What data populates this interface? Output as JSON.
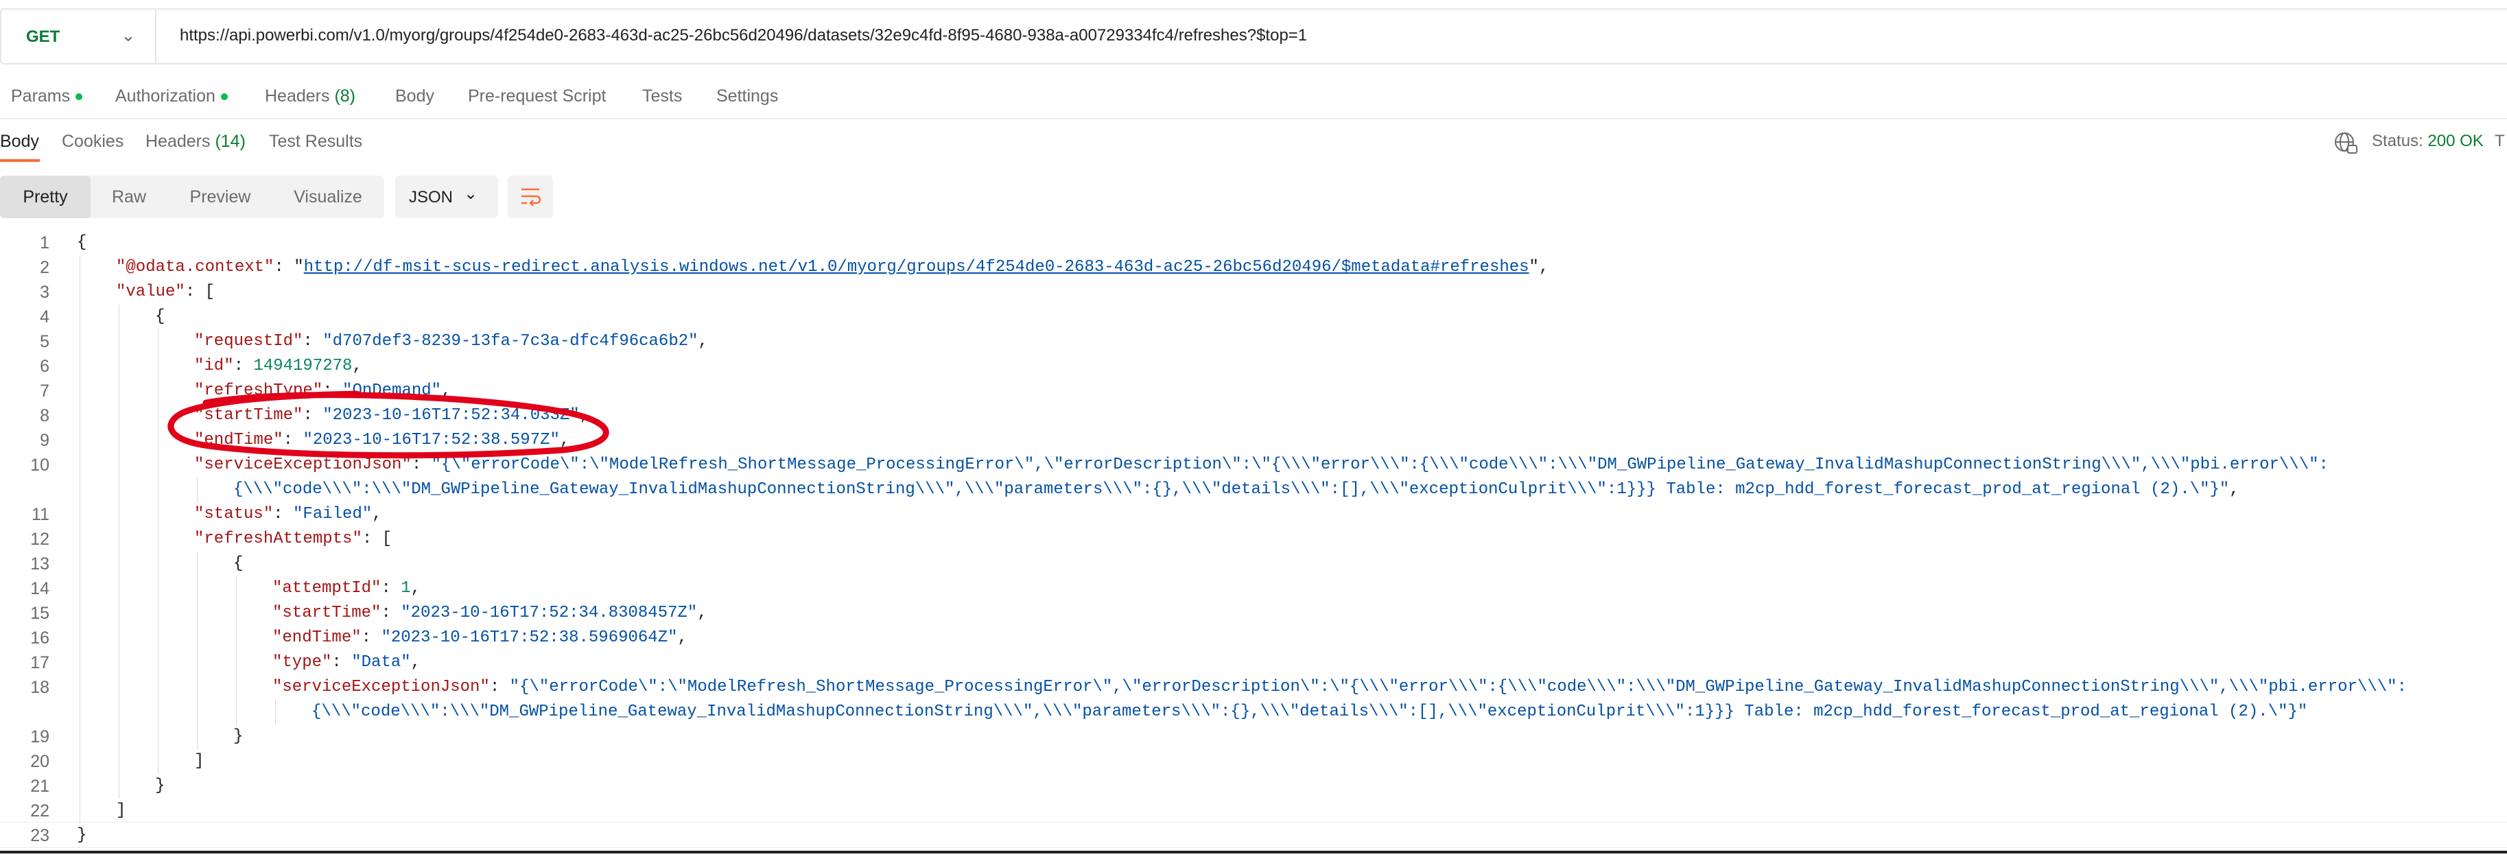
{
  "request": {
    "method": "GET",
    "url": "https://api.powerbi.com/v1.0/myorg/groups/4f254de0-2683-463d-ac25-26bc56d20496/datasets/32e9c4fd-8f95-4680-938a-a00729334fc4/refreshes?$top=1"
  },
  "request_tabs": [
    {
      "label": "Params",
      "dot": true
    },
    {
      "label": "Authorization",
      "dot": true
    },
    {
      "label": "Headers",
      "count": "(8)"
    },
    {
      "label": "Body"
    },
    {
      "label": "Pre-request Script"
    },
    {
      "label": "Tests"
    },
    {
      "label": "Settings"
    }
  ],
  "response_tabs": [
    {
      "label": "Body",
      "active": true
    },
    {
      "label": "Cookies"
    },
    {
      "label": "Headers",
      "count": "(14)"
    },
    {
      "label": "Test Results"
    }
  ],
  "status": {
    "label": "Status:",
    "value": "200 OK",
    "extra": "T"
  },
  "view_modes": [
    "Pretty",
    "Raw",
    "Preview",
    "Visualize"
  ],
  "format": "JSON",
  "icons": [
    "chevron-down-icon",
    "globe-icon",
    "wrap-lines-icon"
  ],
  "colors": {
    "accent": "#ff6c37",
    "success": "#0a7c33",
    "key": "#a31515",
    "string": "#0451a5",
    "number": "#098658",
    "annotation": "#e0001a"
  },
  "code_lines": [
    {
      "n": "1",
      "indent": 0,
      "tokens": [
        {
          "t": "{",
          "c": "p"
        }
      ]
    },
    {
      "n": "2",
      "indent": 1,
      "tokens": [
        {
          "t": "\"@odata.context\"",
          "c": "k"
        },
        {
          "t": ": \"",
          "c": "p"
        },
        {
          "t": "http://df-msit-scus-redirect.analysis.windows.net/v1.0/myorg/groups/4f254de0-2683-463d-ac25-26bc56d20496/$metadata#refreshes",
          "c": "u"
        },
        {
          "t": "\",",
          "c": "p"
        }
      ]
    },
    {
      "n": "3",
      "indent": 1,
      "tokens": [
        {
          "t": "\"value\"",
          "c": "k"
        },
        {
          "t": ": [",
          "c": "p"
        }
      ]
    },
    {
      "n": "4",
      "indent": 2,
      "tokens": [
        {
          "t": "{",
          "c": "p"
        }
      ]
    },
    {
      "n": "5",
      "indent": 3,
      "tokens": [
        {
          "t": "\"requestId\"",
          "c": "k"
        },
        {
          "t": ": ",
          "c": "p"
        },
        {
          "t": "\"d707def3-8239-13fa-7c3a-dfc4f96ca6b2\"",
          "c": "s"
        },
        {
          "t": ",",
          "c": "p"
        }
      ]
    },
    {
      "n": "6",
      "indent": 3,
      "tokens": [
        {
          "t": "\"id\"",
          "c": "k"
        },
        {
          "t": ": ",
          "c": "p"
        },
        {
          "t": "1494197278",
          "c": "n"
        },
        {
          "t": ",",
          "c": "p"
        }
      ]
    },
    {
      "n": "7",
      "indent": 3,
      "tokens": [
        {
          "t": "\"refreshType\"",
          "c": "k"
        },
        {
          "t": ": ",
          "c": "p"
        },
        {
          "t": "\"OnDemand\"",
          "c": "s"
        },
        {
          "t": ",",
          "c": "p"
        }
      ]
    },
    {
      "n": "8",
      "indent": 3,
      "tokens": [
        {
          "t": "\"startTime\"",
          "c": "k"
        },
        {
          "t": ": ",
          "c": "p"
        },
        {
          "t": "\"2023-10-16T17:52:34.033Z\"",
          "c": "s"
        },
        {
          "t": ",",
          "c": "p"
        }
      ]
    },
    {
      "n": "9",
      "indent": 3,
      "tokens": [
        {
          "t": "\"endTime\"",
          "c": "k"
        },
        {
          "t": ": ",
          "c": "p"
        },
        {
          "t": "\"2023-10-16T17:52:38.597Z\"",
          "c": "s"
        },
        {
          "t": ",",
          "c": "p"
        }
      ]
    },
    {
      "n": "10",
      "indent": 3,
      "tokens": [
        {
          "t": "\"serviceExceptionJson\"",
          "c": "k"
        },
        {
          "t": ": ",
          "c": "p"
        },
        {
          "t": "\"{\\\"errorCode\\\":\\\"ModelRefresh_ShortMessage_ProcessingError\\\",\\\"errorDescription\\\":\\\"{\\\\\\\"error\\\\\\\":{\\\\\\\"code\\\\\\\":\\\\\\\"DM_GWPipeline_Gateway_InvalidMashupConnectionString\\\\\\\",\\\\\\\"pbi.error\\\\\\\":",
          "c": "s"
        }
      ]
    },
    {
      "n": "",
      "indent": 4,
      "tokens": [
        {
          "t": "{\\\\\\\"code\\\\\\\":\\\\\\\"DM_GWPipeline_Gateway_InvalidMashupConnectionString\\\\\\\",\\\\\\\"parameters\\\\\\\":{},\\\\\\\"details\\\\\\\":[],\\\\\\\"exceptionCulprit\\\\\\\":1}}} Table: m2cp_hdd_forest_forecast_prod_at_regional (2).\\\"}\"",
          "c": "s"
        },
        {
          "t": ",",
          "c": "p"
        }
      ]
    },
    {
      "n": "11",
      "indent": 3,
      "tokens": [
        {
          "t": "\"status\"",
          "c": "k"
        },
        {
          "t": ": ",
          "c": "p"
        },
        {
          "t": "\"Failed\"",
          "c": "s"
        },
        {
          "t": ",",
          "c": "p"
        }
      ]
    },
    {
      "n": "12",
      "indent": 3,
      "tokens": [
        {
          "t": "\"refreshAttempts\"",
          "c": "k"
        },
        {
          "t": ": [",
          "c": "p"
        }
      ]
    },
    {
      "n": "13",
      "indent": 4,
      "tokens": [
        {
          "t": "{",
          "c": "p"
        }
      ]
    },
    {
      "n": "14",
      "indent": 5,
      "tokens": [
        {
          "t": "\"attemptId\"",
          "c": "k"
        },
        {
          "t": ": ",
          "c": "p"
        },
        {
          "t": "1",
          "c": "n"
        },
        {
          "t": ",",
          "c": "p"
        }
      ]
    },
    {
      "n": "15",
      "indent": 5,
      "tokens": [
        {
          "t": "\"startTime\"",
          "c": "k"
        },
        {
          "t": ": ",
          "c": "p"
        },
        {
          "t": "\"2023-10-16T17:52:34.8308457Z\"",
          "c": "s"
        },
        {
          "t": ",",
          "c": "p"
        }
      ]
    },
    {
      "n": "16",
      "indent": 5,
      "tokens": [
        {
          "t": "\"endTime\"",
          "c": "k"
        },
        {
          "t": ": ",
          "c": "p"
        },
        {
          "t": "\"2023-10-16T17:52:38.5969064Z\"",
          "c": "s"
        },
        {
          "t": ",",
          "c": "p"
        }
      ]
    },
    {
      "n": "17",
      "indent": 5,
      "tokens": [
        {
          "t": "\"type\"",
          "c": "k"
        },
        {
          "t": ": ",
          "c": "p"
        },
        {
          "t": "\"Data\"",
          "c": "s"
        },
        {
          "t": ",",
          "c": "p"
        }
      ]
    },
    {
      "n": "18",
      "indent": 5,
      "tokens": [
        {
          "t": "\"serviceExceptionJson\"",
          "c": "k"
        },
        {
          "t": ": ",
          "c": "p"
        },
        {
          "t": "\"{\\\"errorCode\\\":\\\"ModelRefresh_ShortMessage_ProcessingError\\\",\\\"errorDescription\\\":\\\"{\\\\\\\"error\\\\\\\":{\\\\\\\"code\\\\\\\":\\\\\\\"DM_GWPipeline_Gateway_InvalidMashupConnectionString\\\\\\\",\\\\\\\"pbi.error\\\\\\\":",
          "c": "s"
        }
      ]
    },
    {
      "n": "",
      "indent": 6,
      "tokens": [
        {
          "t": "{\\\\\\\"code\\\\\\\":\\\\\\\"DM_GWPipeline_Gateway_InvalidMashupConnectionString\\\\\\\",\\\\\\\"parameters\\\\\\\":{},\\\\\\\"details\\\\\\\":[],\\\\\\\"exceptionCulprit\\\\\\\":1}}} Table: m2cp_hdd_forest_forecast_prod_at_regional (2).\\\"}\"",
          "c": "s"
        }
      ]
    },
    {
      "n": "19",
      "indent": 4,
      "tokens": [
        {
          "t": "}",
          "c": "p"
        }
      ]
    },
    {
      "n": "20",
      "indent": 3,
      "tokens": [
        {
          "t": "]",
          "c": "p"
        }
      ]
    },
    {
      "n": "21",
      "indent": 2,
      "tokens": [
        {
          "t": "}",
          "c": "p"
        }
      ]
    },
    {
      "n": "22",
      "indent": 1,
      "tokens": [
        {
          "t": "]",
          "c": "p"
        }
      ]
    },
    {
      "n": "23",
      "indent": 0,
      "tokens": [
        {
          "t": "}",
          "c": "p"
        }
      ]
    }
  ]
}
